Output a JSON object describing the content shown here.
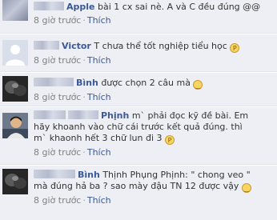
{
  "comments": [
    {
      "author": "Apple",
      "text": "bài 1 cx sai nè. A và C đều đúng @@",
      "time": "8 giờ trước",
      "like": "Thích",
      "emoticon": ""
    },
    {
      "author": "Victor",
      "text": "T chưa thể tốt nghiệp tiểu học",
      "time": "8 giờ trước",
      "like": "Thích",
      "emoticon": "tongue"
    },
    {
      "author": "Bình",
      "text": "được chọn 2 câu mà",
      "time": "8 giờ trước",
      "like": "Thích",
      "emoticon": "smile"
    },
    {
      "author": "Phịnh",
      "text_line1": "m` phải đọc kỹ đề bài. Em",
      "text_line2": "hãy khoanh vào chữ cái trước kết quả đúng. thì",
      "text_line3": "m` khaonh hết 3 chữ lun đi 3",
      "time": "8 giờ trước",
      "like": "Thích",
      "emoticon": "tongue"
    },
    {
      "author": "Bình",
      "text_line1": "Thịnh Phụng Phịnh: \" chong veo \"",
      "text_line2": "mà đúng hả ba ? sao mày đậu TN 12 được vậy",
      "time": "8 giờ trước",
      "like": "Thích",
      "emoticon": "smile"
    }
  ],
  "colors": {
    "link": "#3b5998",
    "text": "#333333",
    "meta": "#808080",
    "background": "#edeff4"
  }
}
